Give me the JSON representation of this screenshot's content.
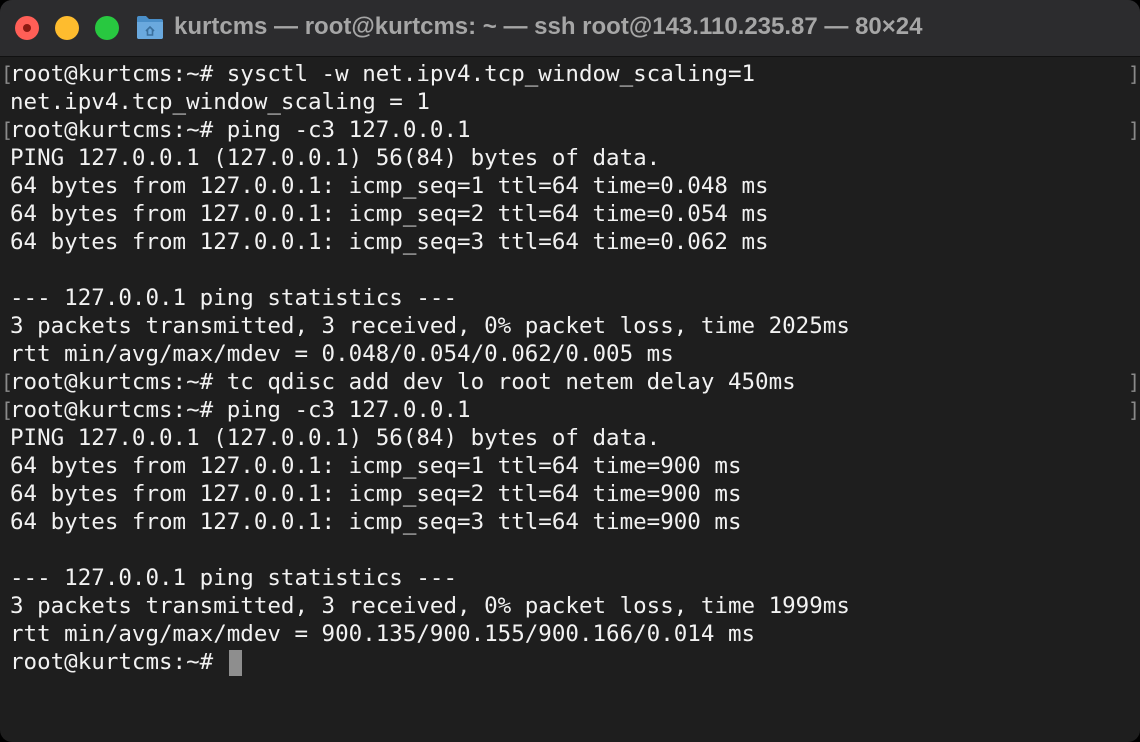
{
  "window": {
    "title": "kurtcms — root@kurtcms: ~ — ssh root@143.110.235.87 — 80×24",
    "icon": "folder-icon",
    "colors": {
      "close": "#ff5f57",
      "minimize": "#febc2e",
      "zoom": "#28c840",
      "background": "#1e1e1e",
      "text": "#f2f2f2"
    }
  },
  "terminal": {
    "lines": [
      {
        "text": "root@kurtcms:~# sysctl -w net.ipv4.tcp_window_scaling=1",
        "mark_left": "[",
        "mark_right": "]"
      },
      {
        "text": "net.ipv4.tcp_window_scaling = 1"
      },
      {
        "text": "root@kurtcms:~# ping -c3 127.0.0.1",
        "mark_left": "[",
        "mark_right": "]"
      },
      {
        "text": "PING 127.0.0.1 (127.0.0.1) 56(84) bytes of data."
      },
      {
        "text": "64 bytes from 127.0.0.1: icmp_seq=1 ttl=64 time=0.048 ms"
      },
      {
        "text": "64 bytes from 127.0.0.1: icmp_seq=2 ttl=64 time=0.054 ms"
      },
      {
        "text": "64 bytes from 127.0.0.1: icmp_seq=3 ttl=64 time=0.062 ms"
      },
      {
        "text": ""
      },
      {
        "text": "--- 127.0.0.1 ping statistics ---"
      },
      {
        "text": "3 packets transmitted, 3 received, 0% packet loss, time 2025ms"
      },
      {
        "text": "rtt min/avg/max/mdev = 0.048/0.054/0.062/0.005 ms"
      },
      {
        "text": "root@kurtcms:~# tc qdisc add dev lo root netem delay 450ms",
        "mark_left": "[",
        "mark_right": "]"
      },
      {
        "text": "root@kurtcms:~# ping -c3 127.0.0.1",
        "mark_left": "[",
        "mark_right": "]"
      },
      {
        "text": "PING 127.0.0.1 (127.0.0.1) 56(84) bytes of data."
      },
      {
        "text": "64 bytes from 127.0.0.1: icmp_seq=1 ttl=64 time=900 ms"
      },
      {
        "text": "64 bytes from 127.0.0.1: icmp_seq=2 ttl=64 time=900 ms"
      },
      {
        "text": "64 bytes from 127.0.0.1: icmp_seq=3 ttl=64 time=900 ms"
      },
      {
        "text": ""
      },
      {
        "text": "--- 127.0.0.1 ping statistics ---"
      },
      {
        "text": "3 packets transmitted, 3 received, 0% packet loss, time 1999ms"
      },
      {
        "text": "rtt min/avg/max/mdev = 900.135/900.155/900.166/0.014 ms"
      }
    ],
    "prompt": "root@kurtcms:~# "
  }
}
